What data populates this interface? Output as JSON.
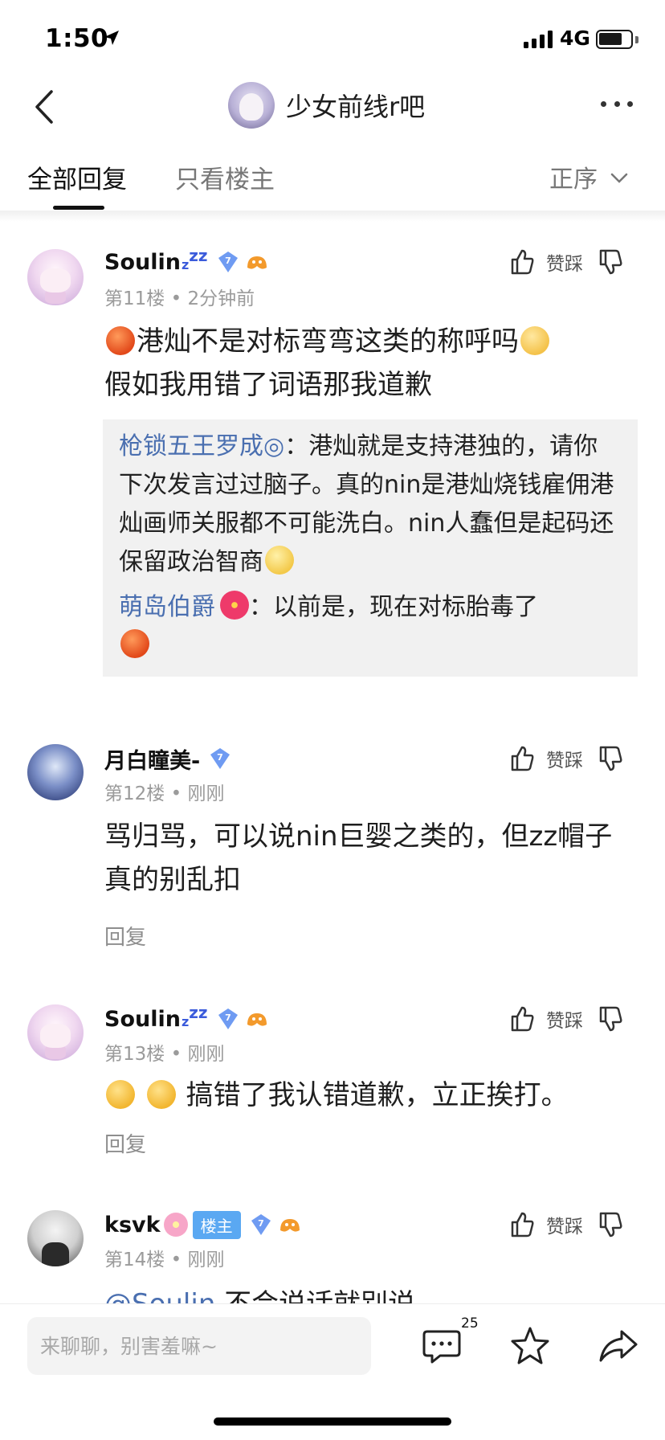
{
  "status_bar": {
    "time": "1:50",
    "network": "4G"
  },
  "nav": {
    "forum_title": "少女前线r吧"
  },
  "tabs": {
    "all_replies": "全部回复",
    "only_op": "只看楼主",
    "sort_label": "正序"
  },
  "vote": {
    "label": "赞踩"
  },
  "posts": [
    {
      "username": "Soulin",
      "name_suffix": "zz",
      "level": "7",
      "floor": "第11楼",
      "time": "2分钟前",
      "content_line1": "港灿不是对标弯弯这类的称呼吗",
      "content_line2": "假如我用错了词语那我道歉",
      "quotes": [
        {
          "name": "枪锁五王罗成◎",
          "sep": "：",
          "text": "港灿就是支持港独的，请你下次发言过过脑子。真的nin是港灿烧钱雇佣港灿画师关服都不可能洗白。nin人蠢但是起码还保留政治智商"
        },
        {
          "name": "萌岛伯爵",
          "sep": "：",
          "text": "以前是，现在对标胎毒了"
        }
      ]
    },
    {
      "username": "月白瞳美-",
      "level": "7",
      "floor": "第12楼",
      "time": "刚刚",
      "content": "骂归骂，可以说nin巨婴之类的，但zz帽子真的别乱扣",
      "reply": "回复"
    },
    {
      "username": "Soulin",
      "name_suffix": "zz",
      "level": "7",
      "floor": "第13楼",
      "time": "刚刚",
      "content": "搞错了我认错道歉，立正挨打。",
      "reply": "回复"
    },
    {
      "username": "ksvk",
      "op_badge": "楼主",
      "level": "7",
      "floor": "第14楼",
      "time": "刚刚",
      "content_partial": "@Soulin",
      "content_partial_2": "不会说话就别说"
    }
  ],
  "bottom_bar": {
    "input_placeholder": "来聊聊，别害羞嘛~",
    "comment_count": "25"
  },
  "colors": {
    "link_blue": "#4a6fb0",
    "op_badge_bg": "#5aa8f2",
    "muted_text": "#9b9b9b"
  },
  "icons": [
    "back-icon",
    "more-icon",
    "chevron-down-icon",
    "thumbs-up-icon",
    "thumbs-down-icon",
    "level-badge-icon",
    "comment-icon",
    "star-icon",
    "share-icon",
    "location-arrow-icon"
  ]
}
